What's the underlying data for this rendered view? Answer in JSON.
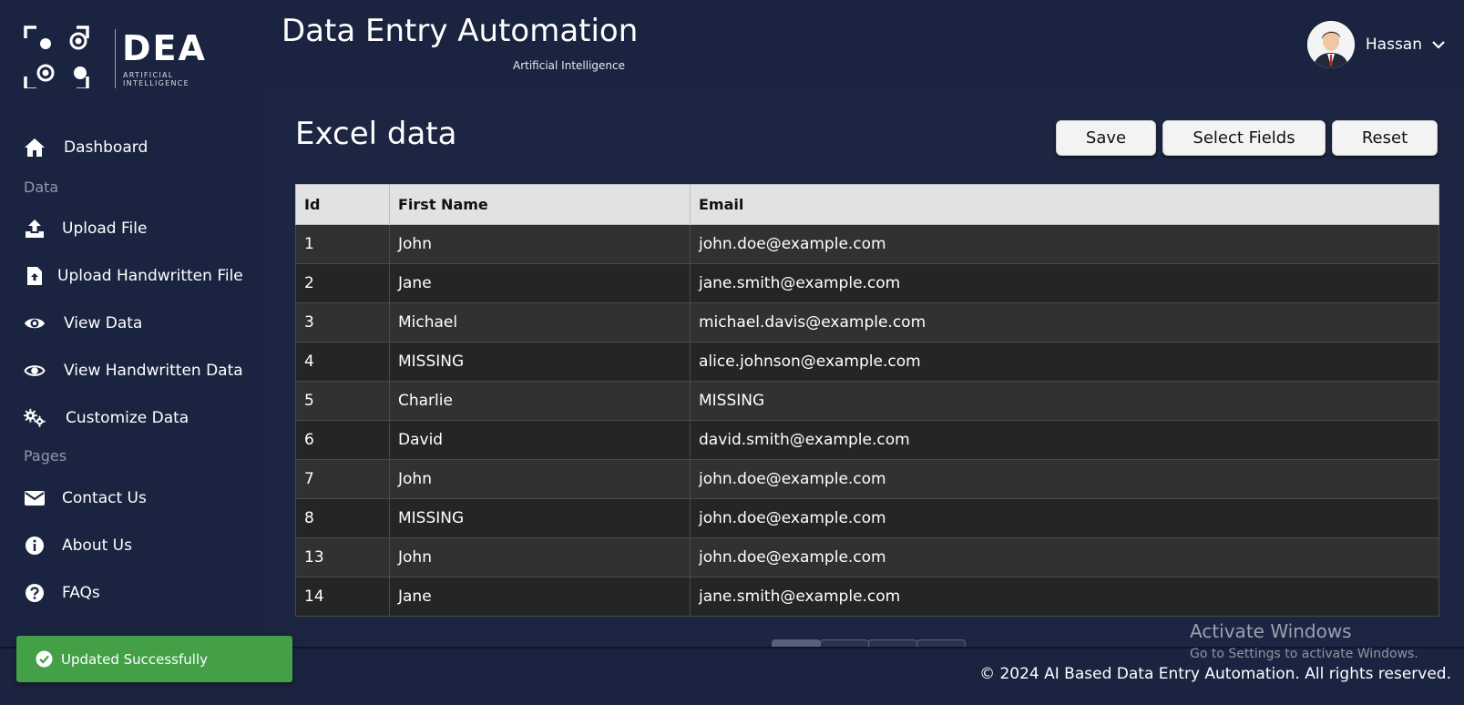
{
  "brand": {
    "logo_text": "DEA",
    "logo_sub": "ARTIFICIAL INTELLIGENCE"
  },
  "header": {
    "title": "Data Entry Automation",
    "subtitle": "Artificial Intelligence"
  },
  "user": {
    "name": "Hassan"
  },
  "sidebar": {
    "items": [
      {
        "label": "Dashboard",
        "icon": "home-icon"
      },
      {
        "label": "Upload File",
        "icon": "upload-icon"
      },
      {
        "label": "Upload Handwritten File",
        "icon": "file-upload-icon"
      },
      {
        "label": "View Data",
        "icon": "eye-icon"
      },
      {
        "label": "View Handwritten Data",
        "icon": "eye-outline-icon"
      },
      {
        "label": "Customize Data",
        "icon": "gears-icon"
      },
      {
        "label": "Contact Us",
        "icon": "envelope-icon"
      },
      {
        "label": "About Us",
        "icon": "info-icon"
      },
      {
        "label": "FAQs",
        "icon": "question-icon"
      }
    ],
    "sections": [
      "Data",
      "Pages"
    ]
  },
  "main": {
    "title": "Excel data",
    "buttons": {
      "save": "Save",
      "select_fields": "Select Fields",
      "reset": "Reset"
    },
    "table": {
      "headers": [
        "Id",
        "First Name",
        "Email"
      ],
      "rows": [
        [
          "1",
          "John",
          "john.doe@example.com"
        ],
        [
          "2",
          "Jane",
          "jane.smith@example.com"
        ],
        [
          "3",
          "Michael",
          "michael.davis@example.com"
        ],
        [
          "4",
          "MISSING",
          "alice.johnson@example.com"
        ],
        [
          "5",
          "Charlie",
          "MISSING"
        ],
        [
          "6",
          "David",
          "david.smith@example.com"
        ],
        [
          "7",
          "John",
          "john.doe@example.com"
        ],
        [
          "8",
          "MISSING",
          "john.doe@example.com"
        ],
        [
          "13",
          "John",
          "john.doe@example.com"
        ],
        [
          "14",
          "Jane",
          "jane.smith@example.com"
        ]
      ]
    }
  },
  "toast": {
    "text": "Updated Successfully"
  },
  "footer": {
    "text": "© 2024 AI Based Data Entry Automation. All rights reserved."
  },
  "watermark": {
    "title": "Activate Windows",
    "subtitle": "Go to Settings to activate Windows."
  },
  "colors": {
    "background": "#1b2540",
    "toast": "#43a047",
    "header_row": "#e2e2e2"
  }
}
